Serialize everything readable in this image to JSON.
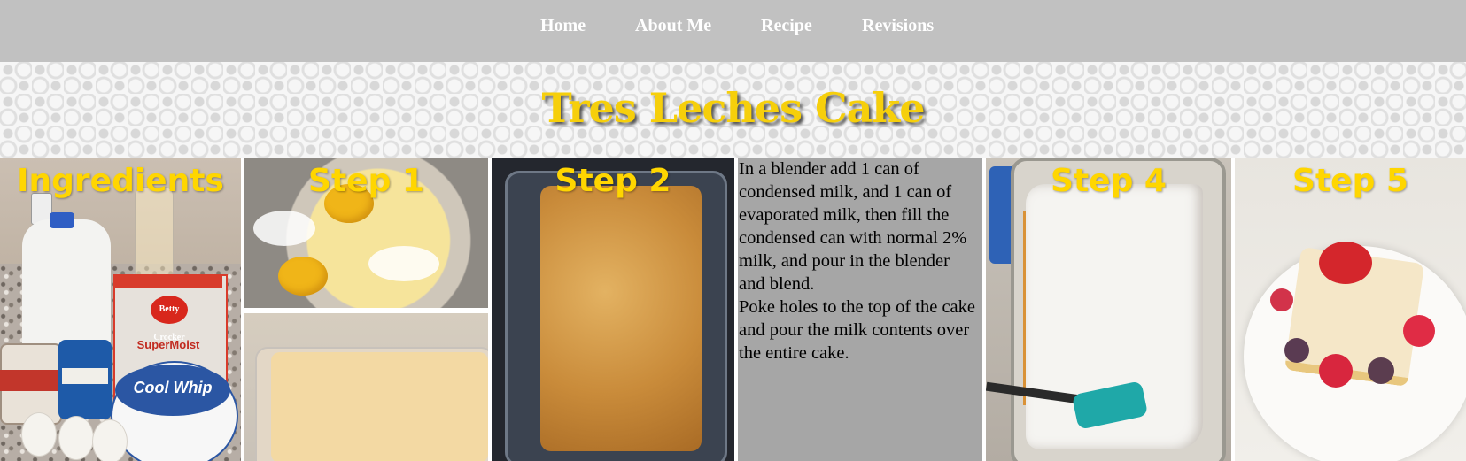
{
  "nav": {
    "items": [
      "Home",
      "About Me",
      "Recipe",
      "Revisions"
    ]
  },
  "hero": {
    "title": "Tres Leches Cake"
  },
  "panels": {
    "ingredients_label": "Ingredients",
    "step1_label": "Step 1",
    "step2_label": "Step 2",
    "step4_label": "Step 4",
    "step5_label": "Step 5",
    "step3_text_1": "In a blender add 1 can of condensed milk, and 1 can of evaporated milk, then fill the condensed can with normal 2% milk, and pour in the blender and blend.",
    "step3_text_2": "Poke holes to the top of the cake and pour the milk contents over the entire cake."
  },
  "photo_text": {
    "box_brand": "Betty Crocker",
    "box_product": "SuperMoist",
    "tub_brand": "Cool Whip"
  },
  "colors": {
    "nav_bg": "#c1c1c1",
    "title_color": "#f6cf0b",
    "label_color": "#ffd600",
    "text_panel_bg": "#a6a6a6"
  }
}
